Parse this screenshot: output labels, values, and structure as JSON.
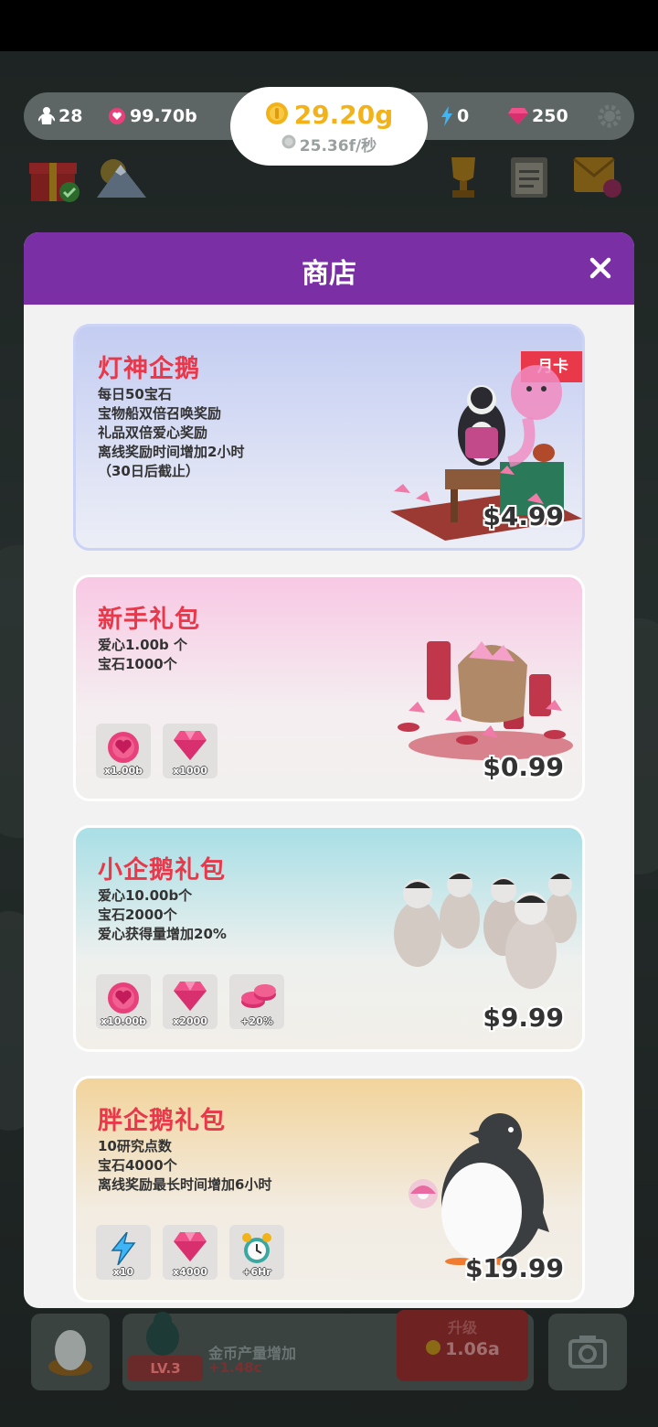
{
  "resources": {
    "penguins": "28",
    "hearts": "99.70b",
    "coins": "29.20g",
    "coin_rate": "25.36f/秒",
    "energy": "0",
    "gems": "250"
  },
  "shop": {
    "title": "商店",
    "cards": [
      {
        "title": "灯神企鹅",
        "badge": "月卡",
        "lines": [
          "每日50宝石",
          "宝物船双倍召唤奖励",
          "礼品双倍爱心奖励",
          "离线奖励时间增加2小时",
          "（30日后截止）"
        ],
        "price": "$4.99"
      },
      {
        "title": "新手礼包",
        "lines": [
          "爱心1.00b 个",
          "宝石1000个"
        ],
        "items": [
          {
            "icon": "heart-coin-icon",
            "qty": "x1.00b"
          },
          {
            "icon": "gem-icon",
            "qty": "x1000"
          }
        ],
        "price": "$0.99"
      },
      {
        "title": "小企鹅礼包",
        "lines": [
          "爱心10.00b个",
          "宝石2000个",
          "爱心获得量增加20%"
        ],
        "items": [
          {
            "icon": "heart-coin-icon",
            "qty": "x10.00b"
          },
          {
            "icon": "gem-icon",
            "qty": "x2000"
          },
          {
            "icon": "heart-coin-stack-icon",
            "qty": "+20%"
          }
        ],
        "price": "$9.99"
      },
      {
        "title": "胖企鹅礼包",
        "lines": [
          "10研究点数",
          "宝石4000个",
          "离线奖励最长时间增加6小时"
        ],
        "items": [
          {
            "icon": "lightning-icon",
            "qty": "x10"
          },
          {
            "icon": "gem-icon",
            "qty": "x4000"
          },
          {
            "icon": "alarm-clock-icon",
            "qty": "+6Hr"
          }
        ],
        "price": "$19.99"
      }
    ]
  },
  "bottom": {
    "level": "LV.3",
    "upgrade_text": "金币产量增加",
    "upgrade_value": "+1.48c",
    "button_label": "升级",
    "button_cost": "1.06a"
  },
  "colors": {
    "header": "#7b2fa5",
    "title_red": "#e8384a",
    "coin_gold": "#f2b21a"
  }
}
